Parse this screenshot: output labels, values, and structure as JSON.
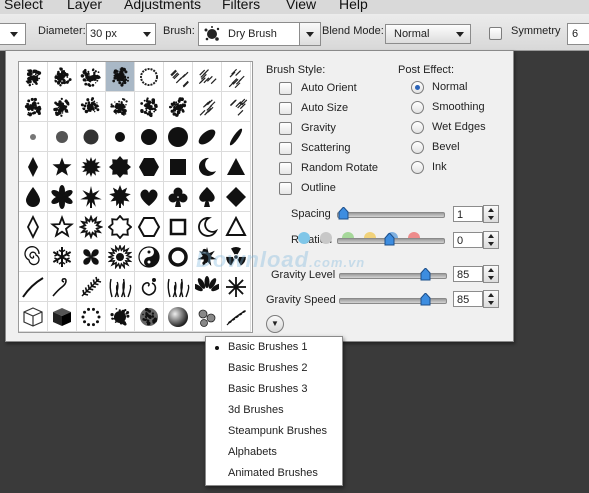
{
  "menubar": {
    "items": [
      "Select",
      "Layer",
      "Adjustments",
      "Filters",
      "View",
      "Help"
    ]
  },
  "toolbar": {
    "diameter_label": "Diameter:",
    "diameter_value": "30 px",
    "brush_label": "Brush:",
    "brush_value": "Dry Brush",
    "blend_label": "Blend Mode:",
    "blend_value": "Normal",
    "symmetry_label": "Symmetry",
    "symmetry_value": "6"
  },
  "panel": {
    "brush_style_title": "Brush Style:",
    "brush_style_options": [
      {
        "label": "Auto Orient",
        "checked": false
      },
      {
        "label": "Auto Size",
        "checked": false
      },
      {
        "label": "Gravity",
        "checked": false
      },
      {
        "label": "Scattering",
        "checked": false
      },
      {
        "label": "Random Rotate",
        "checked": false
      },
      {
        "label": "Outline",
        "checked": false
      }
    ],
    "post_effect_title": "Post Effect:",
    "post_effect_options": [
      {
        "label": "Normal",
        "selected": true
      },
      {
        "label": "Smoothing",
        "selected": false
      },
      {
        "label": "Wet Edges",
        "selected": false
      },
      {
        "label": "Bevel",
        "selected": false
      },
      {
        "label": "Ink",
        "selected": false
      }
    ],
    "spacing_label": "Spacing",
    "spacing_value": "1",
    "spacing_level": 0.02,
    "rotation_label": "Rotation",
    "rotation_value": "0",
    "rotation_level": 0.5,
    "gravity_level_label": "Gravity Level",
    "gravity_level_value": "85",
    "gravity_level_level": 0.85,
    "gravity_speed_label": "Gravity Speed",
    "gravity_speed_value": "85",
    "gravity_speed_level": 0.85,
    "watermark": {
      "main": "Download",
      "suffix": ".com.vn"
    },
    "rotation_dot_colors": [
      "#7fc6e8",
      "#c8c8c8",
      "#a6d89a",
      "#f1d27a",
      "#7fb0e0",
      "#ee8c8c"
    ]
  },
  "brush_grid": {
    "selected_index": 3,
    "icons": [
      "splatter-a-icon",
      "splatter-b-icon",
      "splatter-c-icon",
      "splatter-d-icon",
      "rough-circle-icon",
      "hatch-a-icon",
      "hatch-b-icon",
      "hatch-c-icon",
      "splatter-e-icon",
      "splatter-f-icon",
      "splatter-g-icon",
      "splatter-h-icon",
      "splatter-i-icon",
      "splatter-j-icon",
      "smear-icon",
      "hatch-d-icon",
      "soft-dot-small-icon",
      "soft-dot-medium-icon",
      "soft-dot-large-icon",
      "hard-dot-small-icon",
      "hard-dot-large-icon",
      "hard-dot-xlarge-icon",
      "ellipse-icon",
      "leaf-stroke-icon",
      "diamond-icon",
      "star-icon",
      "starburst-icon",
      "seal-icon",
      "hexagon-icon",
      "square-icon",
      "moon-icon",
      "triangle-icon",
      "drop-icon",
      "flower-icon",
      "maple-leaf-icon",
      "leaf-icon",
      "heart-icon",
      "club-icon",
      "spade-icon",
      "filled-diamond-icon",
      "diamond-outline-icon",
      "star-outline-icon",
      "starburst-outline-icon",
      "seal-outline-icon",
      "hexagon-outline-icon",
      "square-outline-icon",
      "moon-outline-icon",
      "triangle-outline-icon",
      "spiral-icon",
      "snowflake-icon",
      "ornament-icon",
      "mandala-icon",
      "yin-yang-icon",
      "ring-icon",
      "splash-icon",
      "radiation-icon",
      "stroke-icon",
      "swirl-icon",
      "feather-icon",
      "grass-icon",
      "curl-icon",
      "grass-clump-icon",
      "plant-icon",
      "spark-icon",
      "cube-outline-icon",
      "cube-icon",
      "dotted-circle-icon",
      "blob-icon",
      "rough-ball-icon",
      "sphere-icon",
      "bubbles-icon",
      "vine-icon"
    ]
  },
  "brush_set_menu": {
    "expand_label": "▼",
    "selected_index": 0,
    "items": [
      "Basic Brushes 1",
      "Basic Brushes 2",
      "Basic Brushes 3",
      "3d Brushes",
      "Steampunk Brushes",
      "Alphabets",
      "Animated Brushes"
    ]
  }
}
